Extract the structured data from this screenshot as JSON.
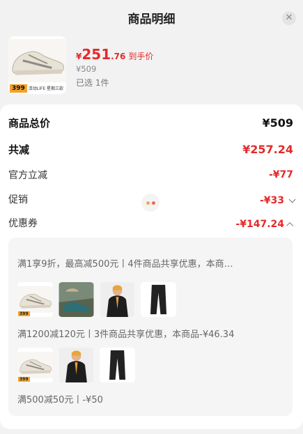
{
  "header": {
    "title": "商品明细",
    "close_glyph": "✕"
  },
  "product": {
    "price_symbol": "¥",
    "price_int": "251",
    "price_dec": ".76",
    "price_tag": "到手价",
    "original_price": "¥509",
    "selected": "已选 1件",
    "badge_price": "399",
    "badge_text": "活动LIFE 星期三款"
  },
  "summary": {
    "total_label": "商品总价",
    "total_value": "¥509",
    "reduce_label": "共减",
    "reduce_value": "¥257.24",
    "official_label": "官方立减",
    "official_value": "-¥77",
    "promo_label": "促销",
    "promo_value": "-¥33",
    "coupon_label": "优惠券",
    "coupon_value": "-¥147.24"
  },
  "coupons": {
    "line1": "满1享9折，最高减500元丨4件商品共享优惠，本商…",
    "line2": "满1200减120元丨3件商品共享优惠，本商品-¥46.34",
    "line3": "满500减50元丨-¥50",
    "thumb_badge": "399"
  },
  "colors": {
    "accent": "#e5292a",
    "panel": "#ffffff",
    "background": "#f2f2f2"
  }
}
